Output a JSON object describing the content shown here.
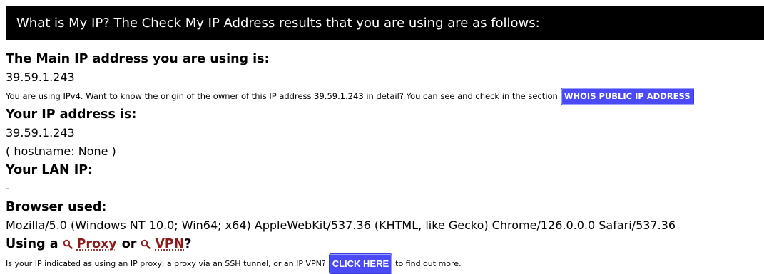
{
  "header": {
    "title": "What is My IP? The Check My IP Address results that you are using are as follows:"
  },
  "main_ip": {
    "heading": "The Main IP address you are using is:",
    "value": "39.59.1.243",
    "note": "You are using IPv4. Want to know the origin of the owner of this IP address 39.59.1.243 in detail? You can see and check in the section",
    "button_label": "WHOIS PUBLIC IP ADDRESS"
  },
  "your_ip": {
    "heading": "Your IP address is:",
    "value": "39.59.1.243",
    "hostname": "( hostname: None )"
  },
  "lan_ip": {
    "heading": "Your LAN IP:",
    "value": "-"
  },
  "browser": {
    "heading": "Browser used:",
    "value": "Mozilla/5.0 (Windows NT 10.0; Win64; x64) AppleWebKit/537.36 (KHTML, like Gecko) Chrome/126.0.0.0 Safari/537.36"
  },
  "proxy": {
    "prefix": "Using a",
    "proxy_link": "Proxy",
    "or": "or",
    "vpn_link": "VPN",
    "suffix": "?",
    "note_before": "Is your IP indicated as using an IP proxy, a proxy via an SSH tunnel, or an IP VPN?",
    "button_label": "CLICK HERE",
    "note_after": "to find out more.",
    "icon": "magnifier-icon",
    "link_color": "#8b1a1a"
  },
  "colors": {
    "header_bg": "#000000",
    "button_bg": "#4a4af7"
  }
}
